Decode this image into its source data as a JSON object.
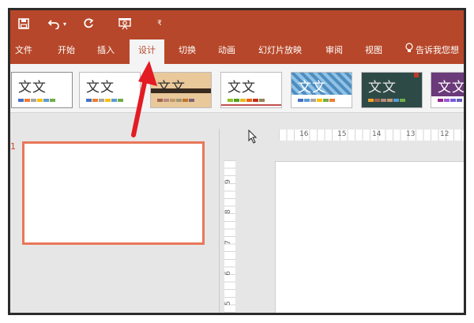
{
  "quick_access": {
    "save_icon": "save-icon",
    "undo_icon": "undo-icon",
    "redo_icon": "redo-icon",
    "start_from_beginning_icon": "slideshow-start-icon",
    "customize_icon": "customize-dropdown-icon"
  },
  "tabs": [
    {
      "label": "文件"
    },
    {
      "label": "开始"
    },
    {
      "label": "插入"
    },
    {
      "label": "设计",
      "active": true
    },
    {
      "label": "切换"
    },
    {
      "label": "动画"
    },
    {
      "label": "幻灯片放映"
    },
    {
      "label": "审阅"
    },
    {
      "label": "视图"
    },
    {
      "label": "告诉我您想"
    }
  ],
  "themes": [
    {
      "label": "文文",
      "bg": "#ffffff"
    },
    {
      "label": "文文",
      "bg": "#ffffff"
    },
    {
      "label": "文文",
      "bg": "#e9c89a"
    },
    {
      "label": "文文",
      "bg": "#ffffff"
    },
    {
      "label": "文文",
      "bg": "#6ea7d2"
    },
    {
      "label": "文文",
      "bg": "#2e4a47"
    },
    {
      "label": "文文",
      "bg": "#ffffff"
    }
  ],
  "slides": {
    "number": "1"
  },
  "ruler": {
    "horizontal": [
      "16",
      "15",
      "14",
      "13",
      "12"
    ],
    "vertical": [
      "9",
      "8",
      "7",
      "6",
      "5"
    ]
  },
  "colors": {
    "accent": "#b7472a",
    "selection": "#e8775a",
    "annotation_arrow": "#e31b23"
  }
}
